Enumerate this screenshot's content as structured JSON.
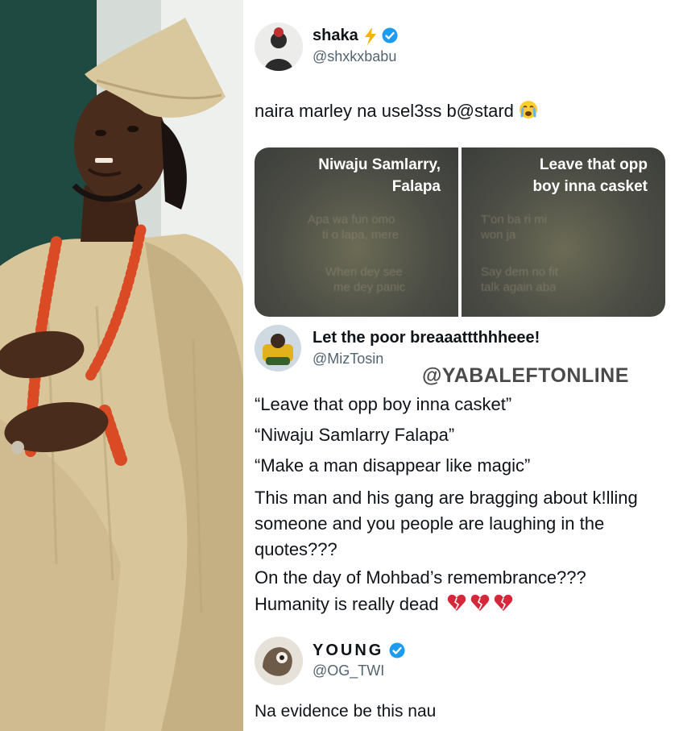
{
  "tweets": [
    {
      "display_name": "shaka",
      "handle": "@shxkxbabu",
      "text": "naira marley na usel3ss b@stard",
      "text_emoji": "loudly-crying-face"
    },
    {
      "display_name": "Let the poor breaaattthhheee!",
      "handle": "@MizTosin",
      "lines": [
        "“Leave that opp boy inna casket”",
        "“Niwaju Samlarry Falapa”",
        "“Make a man disappear like magic”",
        "This man and his gang are bragging about k!lling",
        "someone and you people are laughing in the",
        "quotes???",
        "On the day of Mohbad’s remembrance???",
        "Humanity is really dead"
      ],
      "line_emoji": "broken-heart x3"
    },
    {
      "display_name": "YOUNG",
      "handle": "@OG_TWI",
      "text": "Na evidence be this nau"
    }
  ],
  "media": {
    "left": {
      "title_line1": "Niwaju Samlarry,",
      "title_line2": "Falapa",
      "faded1": "Apa wa fun omo",
      "faded2": "ti o lapa, mere",
      "faded3": "When dey see",
      "faded4": "me dey panic"
    },
    "right": {
      "title_line1": "Leave that opp",
      "title_line2": "boy inna casket",
      "faded1": "T'on ba ri mi",
      "faded2": "won ja",
      "faded3": "Say dem no fit",
      "faded4": "talk again aba"
    }
  },
  "watermark": "@YABALEFTONLINE",
  "colors": {
    "verified": "#1d9bf0",
    "heart": "#d6283a",
    "text": "#0f1419",
    "handle": "#536471"
  }
}
